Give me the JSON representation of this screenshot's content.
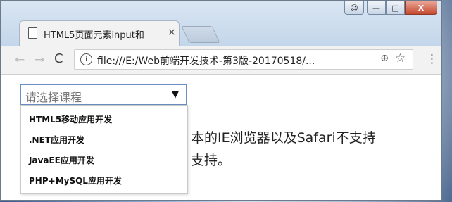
{
  "tab": {
    "title": "HTML5页面元素input和",
    "close": "×"
  },
  "window_controls": {
    "user": "☺",
    "minimize": "—",
    "maximize": "□",
    "close": "X"
  },
  "toolbar": {
    "back": "←",
    "forward": "→",
    "reload": "C",
    "info_glyph": "i",
    "url": "file:///E:/Web前端开发技术-第3版-20170518/...",
    "zoom": "⊕",
    "star": "☆",
    "menu": "⋮"
  },
  "select": {
    "placeholder": "请选择课程",
    "arrow": "▼",
    "options": [
      "HTML5移动应用开发",
      ".NET应用开发",
      "JavaEE应用开发",
      "PHP+MySQL应用开发"
    ]
  },
  "paragraph": {
    "line1": "本的IE浏览器以及Safari不支持",
    "line2": "支持。"
  }
}
